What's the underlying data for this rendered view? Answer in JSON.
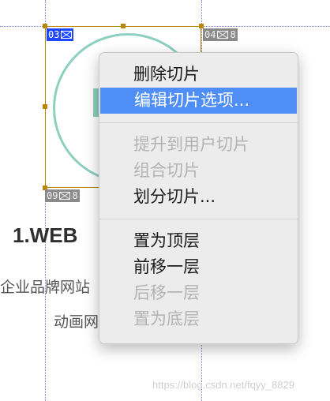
{
  "slices": {
    "active": {
      "number": "03",
      "icon": "image-icon"
    },
    "right": {
      "number": "04",
      "suffix": "8",
      "icon": "image-icon"
    },
    "bottom": {
      "number": "09",
      "suffix": "8",
      "icon": "image-icon"
    }
  },
  "page": {
    "heading": "1.WEB",
    "line1": "企业品牌网站",
    "line2": "动画网"
  },
  "menu": {
    "group1": [
      {
        "label": "删除切片",
        "state": "normal"
      },
      {
        "label": "编辑切片选项...",
        "state": "highlighted"
      }
    ],
    "group2": [
      {
        "label": "提升到用户切片",
        "state": "disabled"
      },
      {
        "label": "组合切片",
        "state": "disabled"
      },
      {
        "label": "划分切片...",
        "state": "normal"
      }
    ],
    "group3": [
      {
        "label": "置为顶层",
        "state": "normal"
      },
      {
        "label": "前移一层",
        "state": "normal"
      },
      {
        "label": "后移一层",
        "state": "disabled"
      },
      {
        "label": "置为底层",
        "state": "disabled"
      }
    ]
  },
  "colors": {
    "highlight": "#4f8ef7",
    "slice_active": "#1e46ff",
    "slice_border": "#b8860b",
    "circle": "#8ed0c0"
  },
  "watermark": "https://blog.csdn.net/fqyy_8829"
}
